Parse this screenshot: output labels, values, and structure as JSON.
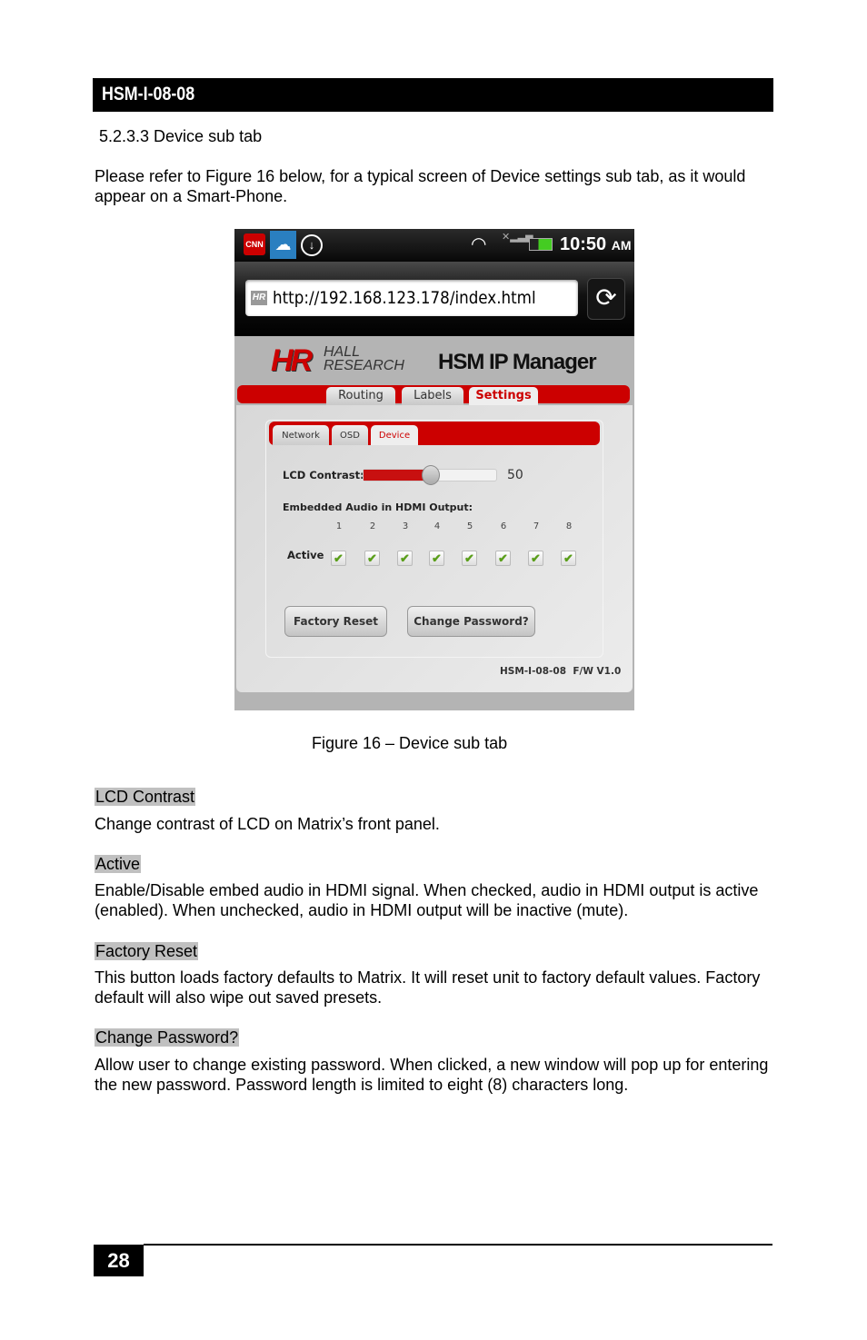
{
  "header": {
    "title": "HSM-I-08-08"
  },
  "section": {
    "heading": "5.2.3.3 Device sub tab",
    "intro": "Please refer to Figure 16 below, for a typical screen of Device settings sub tab, as it would appear on a Smart-Phone."
  },
  "phone": {
    "status": {
      "time": "10:50",
      "ampm": "AM",
      "icons": [
        "cnn-icon",
        "chat-bubble-icon",
        "download-icon",
        "wifi-icon",
        "no-signal-icon",
        "battery-icon"
      ]
    },
    "browser": {
      "url": "http://192.168.123.178/index.html",
      "favicon": "HR",
      "reload_icon": "reload-icon"
    },
    "app": {
      "logo_mark": "HR",
      "logo_text_1": "HALL",
      "logo_text_2": "RESEARCH",
      "title": "HSM IP Manager",
      "main_tabs": [
        {
          "label": "Routing"
        },
        {
          "label": "Labels"
        },
        {
          "label": "Settings",
          "active": true
        }
      ],
      "sub_tabs": [
        {
          "label": "Network"
        },
        {
          "label": "OSD"
        },
        {
          "label": "Device",
          "active": true
        }
      ],
      "lcd_contrast": {
        "label": "LCD Contrast:",
        "value": "50",
        "percent": 50
      },
      "audio": {
        "label": "Embedded Audio in HDMI Output:",
        "row_label": "Active",
        "channels": [
          "1",
          "2",
          "3",
          "4",
          "5",
          "6",
          "7",
          "8"
        ],
        "checked": [
          true,
          true,
          true,
          true,
          true,
          true,
          true,
          true
        ]
      },
      "buttons": {
        "factory_reset": "Factory Reset",
        "change_password": "Change Password?"
      },
      "firmware": "HSM-I-08-08  F/W V1.0"
    },
    "colors": {
      "accent": "#cc0000",
      "check": "#5a9e1a"
    }
  },
  "caption": "Figure 16 – Device sub tab",
  "descriptions": [
    {
      "term": "LCD Contrast",
      "text": "Change contrast of LCD on Matrix’s front panel."
    },
    {
      "term": "Active",
      "text": "Enable/Disable embed audio in HDMI signal. When checked, audio in HDMI output is active (enabled). When unchecked, audio in HDMI output will be inactive (mute)."
    },
    {
      "term": "Factory Reset",
      "text": "This button loads factory defaults to Matrix.  It will reset unit to factory default values. Factory default will also wipe out saved presets."
    },
    {
      "term": "Change Password?",
      "text": "Allow user to change existing password.  When clicked, a new window will pop up for entering the new password. Password length is limited to eight (8) characters long."
    }
  ],
  "footer": {
    "page_number": "28"
  }
}
